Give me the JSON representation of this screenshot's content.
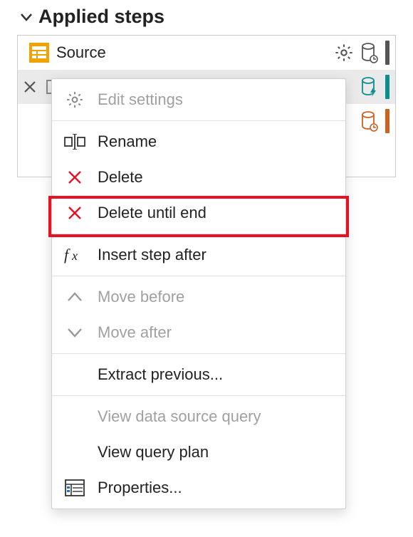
{
  "panel": {
    "title": "Applied steps"
  },
  "steps": {
    "source_label": "Source"
  },
  "menu": {
    "edit_settings": "Edit settings",
    "rename": "Rename",
    "delete": "Delete",
    "delete_until_end": "Delete until end",
    "insert_step_after": "Insert step after",
    "move_before": "Move before",
    "move_after": "Move after",
    "extract_previous": "Extract previous...",
    "view_data_source_query": "View data source query",
    "view_query_plan": "View query plan",
    "properties": "Properties..."
  }
}
